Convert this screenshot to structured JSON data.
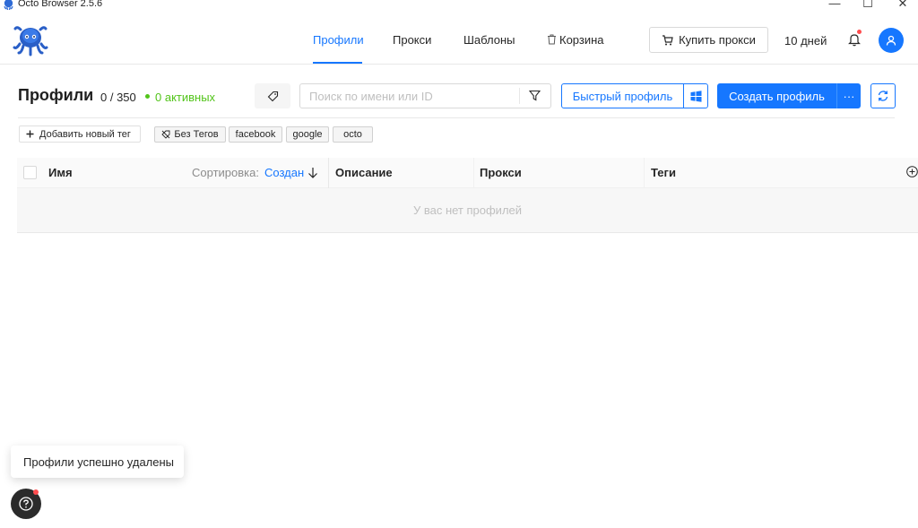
{
  "window": {
    "title": "Octo Browser 2.5.6",
    "minimize": "—",
    "maximize": "☐",
    "close": "✕"
  },
  "nav": {
    "tabs": [
      {
        "label": "Профили",
        "active": true
      },
      {
        "label": "Прокси",
        "active": false
      },
      {
        "label": "Шаблоны",
        "active": false
      },
      {
        "label": "Корзина",
        "active": false
      }
    ],
    "buy_proxy": "Купить прокси",
    "days_left": "10 дней"
  },
  "header": {
    "title": "Профили",
    "count": "0 / 350",
    "active": "0 активных",
    "search_placeholder": "Поиск по имени или ID",
    "quick_profile": "Быстрый профиль",
    "create_profile": "Создать профиль",
    "more": "···"
  },
  "tags": {
    "add_tag": "Добавить новый тег",
    "chips": [
      "Без Тегов",
      "facebook",
      "google",
      "octo"
    ]
  },
  "table": {
    "columns": {
      "name": "Имя",
      "description": "Описание",
      "proxy": "Прокси",
      "tags": "Теги"
    },
    "sort_label": "Сортировка:",
    "sort_value": "Создан",
    "empty": "У вас нет профилей"
  },
  "toast": {
    "message": "Профили успешно удалены"
  },
  "colors": {
    "accent": "#1677ff",
    "active": "#52c41a",
    "badge": "#ff4d4f"
  }
}
